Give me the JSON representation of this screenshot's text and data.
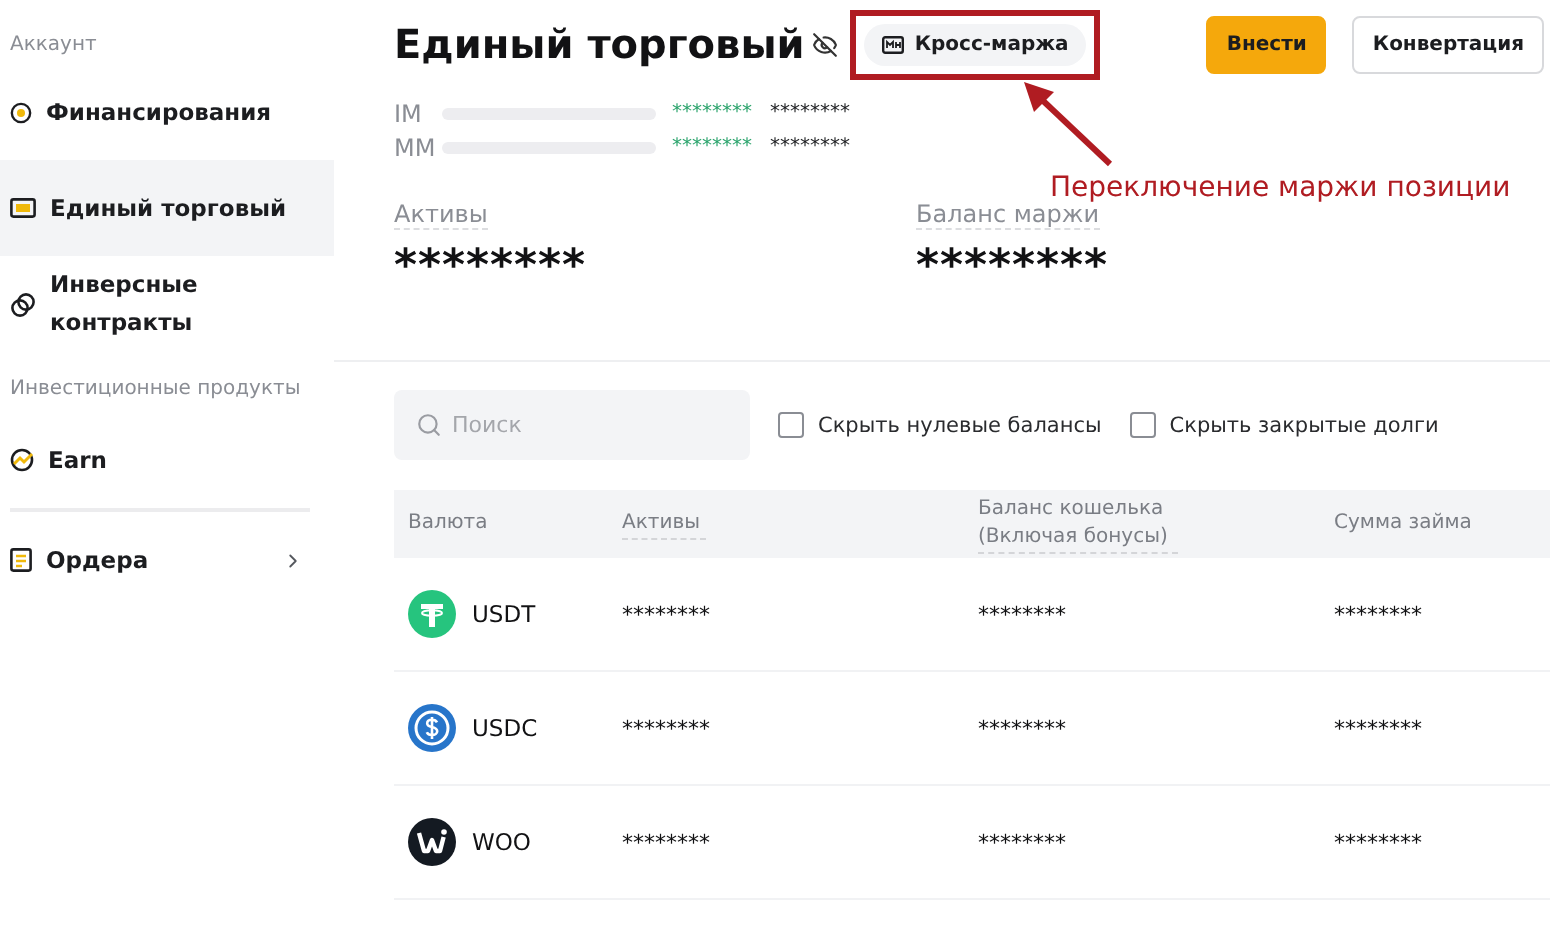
{
  "sidebar": {
    "sections": [
      {
        "heading": "Аккаунт",
        "items": [
          {
            "label": "Финансирования",
            "kind": "coin",
            "selected": false,
            "expandable": false
          },
          {
            "label": "Единый торговый",
            "kind": "card",
            "selected": true,
            "expandable": false
          },
          {
            "label": "Инверсные контракты",
            "kind": "rings",
            "selected": false,
            "expandable": false
          }
        ]
      },
      {
        "heading": "Инвестиционные продукты",
        "items": [
          {
            "label": "Earn",
            "kind": "earn",
            "selected": false,
            "expandable": false
          },
          {
            "label": "Ордера",
            "kind": "doc",
            "selected": false,
            "expandable": true
          }
        ]
      }
    ]
  },
  "header": {
    "title": "Единый торговый",
    "margin_mode": {
      "label": "Кросс-маржа",
      "highlighted": true
    },
    "buttons": [
      {
        "label": "Внести",
        "kind": "primary"
      },
      {
        "label": "Конвертация",
        "kind": "secondary"
      }
    ]
  },
  "annotation": {
    "label": "Переключение маржи позиции"
  },
  "margins": [
    {
      "label": "IM",
      "value_1": "********",
      "value_2": "********"
    },
    {
      "label": "MM",
      "value_1": "********",
      "value_2": "********"
    }
  ],
  "summary": [
    {
      "label": "Активы",
      "value": "********"
    },
    {
      "label": "Баланс маржи",
      "value": "********"
    }
  ],
  "filters": {
    "search": {
      "placeholder": "Поиск"
    },
    "checkboxes": [
      {
        "label": "Скрыть нулевые балансы",
        "checked": false
      },
      {
        "label": "Скрыть закрытые долги",
        "checked": false
      }
    ]
  },
  "table": {
    "columns": [
      "Валюта",
      "Активы",
      "Баланс кошелька (Включая бонусы)",
      "Сумма займа"
    ],
    "rows": [
      {
        "kind": "usdt",
        "cells": [
          "USDT",
          "********",
          "********",
          "********"
        ]
      },
      {
        "kind": "usdc",
        "cells": [
          "USDC",
          "********",
          "********",
          "********"
        ]
      },
      {
        "kind": "woo",
        "cells": [
          "WOO",
          "********",
          "********",
          "********"
        ]
      }
    ]
  }
}
